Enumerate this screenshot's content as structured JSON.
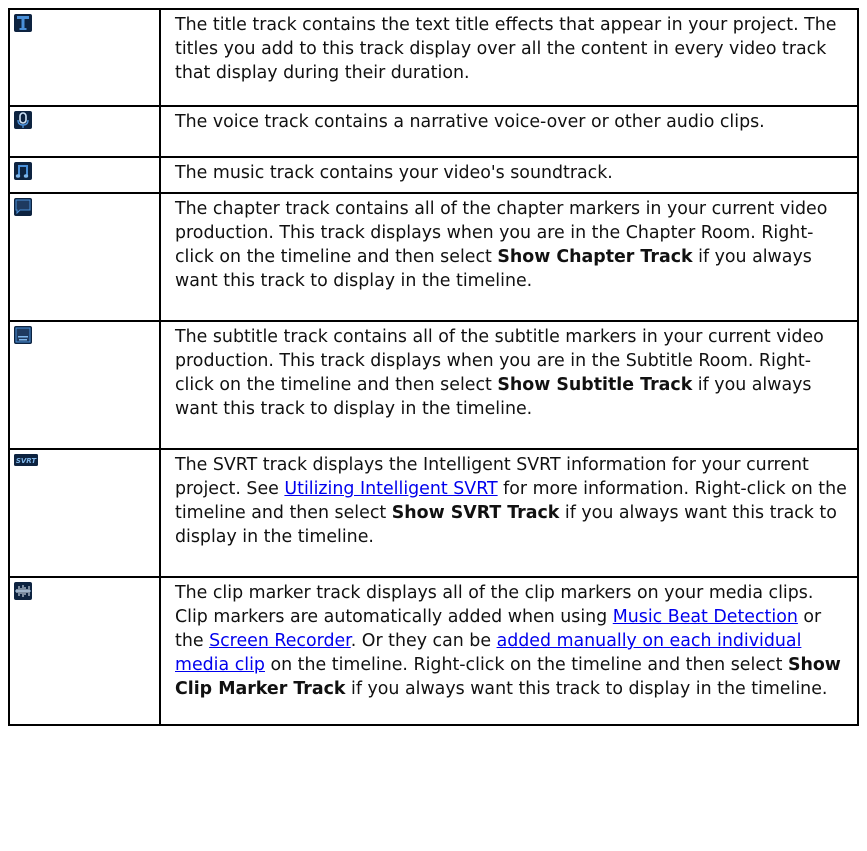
{
  "rows": [
    {
      "icon": "title-track-icon",
      "text": "The title track contains the text title effects that appear in your project. The titles you add to this track display over all the content in every video track that display during their duration."
    },
    {
      "icon": "voice-track-icon",
      "text": "The voice track contains a narrative voice-over or other audio clips."
    },
    {
      "icon": "music-track-icon",
      "text": "The music track contains your video's soundtrack."
    },
    {
      "icon": "chapter-track-icon",
      "text_a": "The chapter track contains all of the chapter markers in your current video production. This track displays when you are in the Chapter Room. Right-click on the timeline and then select ",
      "bold": "Show Chapter Track",
      "text_b": " if you always want this track to display in the timeline."
    },
    {
      "icon": "subtitle-track-icon",
      "text_a": "The subtitle track contains all of the subtitle markers in your current video production. This track displays when you are in the Subtitle Room. Right-click on the timeline and then select ",
      "bold": "Show Subtitle Track",
      "text_b": " if you always want this track to display in the timeline."
    },
    {
      "icon": "svrt-track-icon",
      "icon_text": "SVRT",
      "text_a": "The SVRT track displays the Intelligent SVRT information for your current project. See ",
      "link": "Utilizing Intelligent SVRT",
      "text_b": " for more information. Right-click on the timeline and then select ",
      "bold": "Show SVRT Track",
      "text_c": " if you always want this track to display in the timeline."
    },
    {
      "icon": "clip-marker-track-icon",
      "text_a": "The clip marker track displays all of the clip markers on your media clips. Clip markers are automatically added when using ",
      "link1": "Music Beat Detection",
      "text_b": " or the ",
      "link2": "Screen Recorder",
      "text_c": ". Or they can be ",
      "link3": "added manually on each individual media clip",
      "text_d": " on the timeline. Right-click on the timeline and then select ",
      "bold": "Show Clip Marker Track",
      "text_e": " if you always want this track to display in the timeline."
    }
  ],
  "colors": {
    "link": "#0000ee",
    "border": "#000000",
    "icon_bg": "#0d2340",
    "icon_blue": "#4a90d9"
  }
}
